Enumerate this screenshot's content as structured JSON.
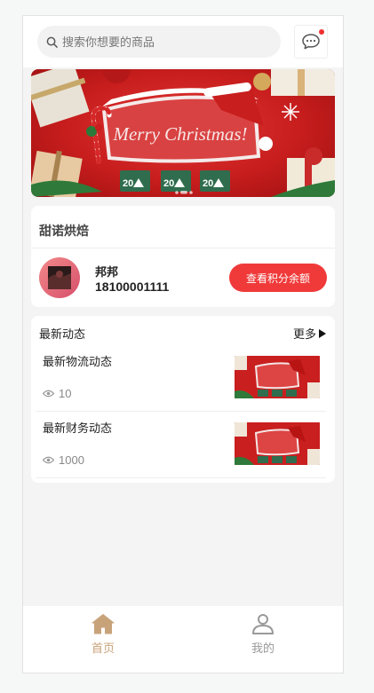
{
  "search": {
    "placeholder": "搜索你想要的商品"
  },
  "colors": {
    "accent": "#f03a3a",
    "tab_active": "#c8a37a",
    "tab_inactive": "#999999"
  },
  "icons": {
    "search": "search-icon",
    "message": "chat-bubble-icon",
    "home": "home-icon",
    "profile": "user-icon",
    "views": "eye-icon"
  },
  "banner": {
    "text": "Merry Christmas!"
  },
  "shop": {
    "name": "甜诺烘焙",
    "user_name": "邦邦",
    "user_phone": "18100001111",
    "points_button": "查看积分余额"
  },
  "news": {
    "heading": "最新动态",
    "more": "更多",
    "items": [
      {
        "title": "最新物流动态",
        "views": "10"
      },
      {
        "title": "最新财务动态",
        "views": "1000"
      }
    ]
  },
  "tabbar": {
    "home": "首页",
    "mine": "我的"
  }
}
